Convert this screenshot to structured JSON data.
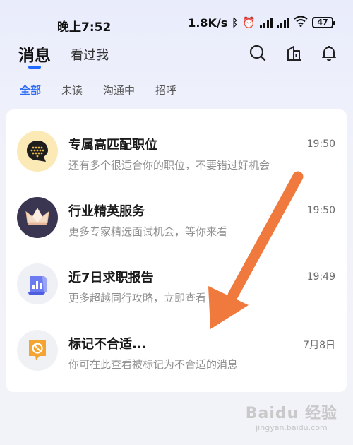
{
  "status": {
    "time": "晚上7:52",
    "speed": "1.8K/s",
    "battery": "47"
  },
  "header": {
    "tab_messages": "消息",
    "tab_viewed_me": "看过我"
  },
  "filters": [
    "全部",
    "未读",
    "沟通中",
    "招呼"
  ],
  "messages": [
    {
      "title": "专属高匹配职位",
      "subtitle": "还有多个很适合你的职位，不要错过好机会",
      "time": "19:50"
    },
    {
      "title": "行业精英服务",
      "subtitle": "更多专家精选面试机会，等你来看",
      "time": "19:50"
    },
    {
      "title": "近7日求职报告",
      "subtitle": "更多超越同行攻略，立即查看",
      "time": "19:49"
    },
    {
      "title": "标记不合适...",
      "subtitle": "你可在此查看被标记为不合适的消息",
      "time": "7月8日"
    }
  ],
  "watermark": {
    "logo": "Baidu 经验",
    "url": "jingyan.baidu.com"
  },
  "colors": {
    "accent": "#1f6bff",
    "annotation_arrow": "#f07a3e"
  }
}
